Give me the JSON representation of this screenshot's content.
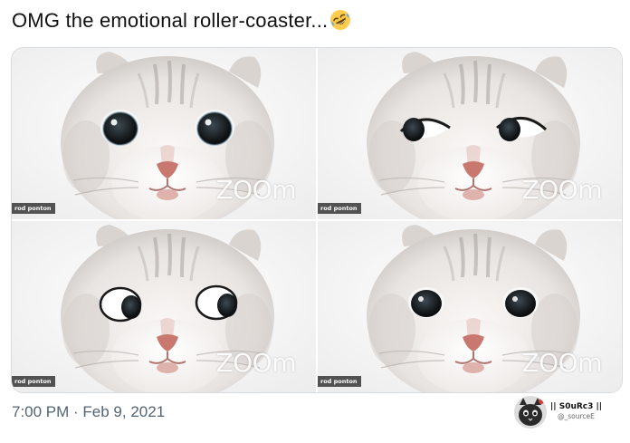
{
  "tweet": {
    "text": "OMG the emotional roller-coaster...",
    "emoji_icon": "rolling-on-floor-laughing-emoji"
  },
  "media": {
    "frames": [
      {
        "participant_name": "rod ponton",
        "watermark": "ZOOm",
        "expression": "sad-wide-eyes"
      },
      {
        "participant_name": "rod ponton",
        "watermark": "ZOOm",
        "expression": "side-glance"
      },
      {
        "participant_name": "rod ponton",
        "watermark": "ZOOm",
        "expression": "looking-right"
      },
      {
        "participant_name": "rod ponton",
        "watermark": "ZOOm",
        "expression": "neutral"
      }
    ]
  },
  "footer": {
    "timestamp": "7:00 PM · Feb 9, 2021"
  },
  "source": {
    "name": "|| S0uRc3 ||",
    "handle": "@_sourceE",
    "avatar_icon": "cat-avatar-icon"
  },
  "colors": {
    "text": "#111111",
    "muted": "#536471",
    "border": "#d6dbe0",
    "name_tag_bg": "#3c3c3c",
    "cat_fur": "#ebe8e5",
    "cat_nose": "#c97870"
  }
}
